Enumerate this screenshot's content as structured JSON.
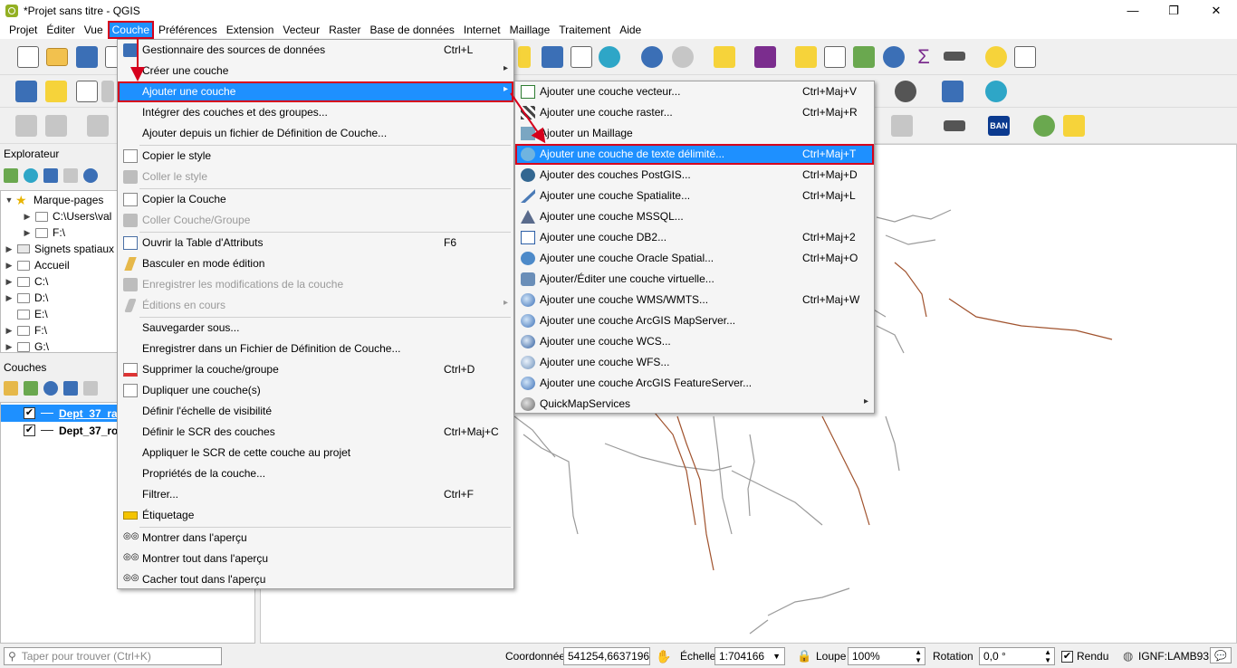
{
  "window": {
    "title": "*Projet sans titre - QGIS",
    "minimize": "—",
    "maximize": "❐",
    "close": "✕"
  },
  "menubar": [
    {
      "label": "Projet"
    },
    {
      "label": "Éditer"
    },
    {
      "label": "Vue"
    },
    {
      "label": "Couche"
    },
    {
      "label": "Préférences"
    },
    {
      "label": "Extension"
    },
    {
      "label": "Vecteur"
    },
    {
      "label": "Raster"
    },
    {
      "label": "Base de données"
    },
    {
      "label": "Internet"
    },
    {
      "label": "Maillage"
    },
    {
      "label": "Traitement"
    },
    {
      "label": "Aide"
    }
  ],
  "toolbar": {
    "ban_label": "BAN"
  },
  "browser": {
    "title": "Explorateur",
    "items": [
      {
        "label": "Marque-pages"
      },
      {
        "label": "C:\\Users\\val"
      },
      {
        "label": "F:\\"
      },
      {
        "label": "Signets spatiaux"
      },
      {
        "label": "Accueil"
      },
      {
        "label": "C:\\"
      },
      {
        "label": "D:\\"
      },
      {
        "label": "E:\\"
      },
      {
        "label": "F:\\"
      },
      {
        "label": "G:\\"
      }
    ]
  },
  "layers": {
    "title": "Couches",
    "items": [
      {
        "label": "Dept_37_ra",
        "checked": "✔"
      },
      {
        "label": "Dept_37_ro",
        "checked": "✔"
      }
    ]
  },
  "couche_menu": {
    "items": [
      {
        "label": "Gestionnaire des sources de données",
        "shortcut": "Ctrl+L"
      },
      {
        "label": "Créer une couche",
        "submenu": "▸"
      },
      {
        "label": "Ajouter une couche",
        "submenu": "▸"
      },
      {
        "label": "Intégrer des couches et des groupes..."
      },
      {
        "label": "Ajouter depuis un fichier de Définition de Couche..."
      },
      {
        "label": "Copier le style"
      },
      {
        "label": "Coller le style"
      },
      {
        "label": "Copier la Couche"
      },
      {
        "label": "Coller Couche/Groupe"
      },
      {
        "label": "Ouvrir la Table d'Attributs",
        "shortcut": "F6"
      },
      {
        "label": "Basculer en mode édition"
      },
      {
        "label": "Enregistrer les modifications de la couche"
      },
      {
        "label": "Éditions en cours",
        "submenu": "▸"
      },
      {
        "label": "Sauvegarder sous..."
      },
      {
        "label": "Enregistrer dans un Fichier de Définition de Couche..."
      },
      {
        "label": "Supprimer la couche/groupe",
        "shortcut": "Ctrl+D"
      },
      {
        "label": "Dupliquer une couche(s)"
      },
      {
        "label": "Définir l'échelle de visibilité"
      },
      {
        "label": "Définir le SCR des couches",
        "shortcut": "Ctrl+Maj+C"
      },
      {
        "label": "Appliquer le SCR de cette couche au projet"
      },
      {
        "label": "Propriétés de la couche..."
      },
      {
        "label": "Filtrer...",
        "shortcut": "Ctrl+F"
      },
      {
        "label": "Étiquetage"
      },
      {
        "label": "Montrer dans l'aperçu"
      },
      {
        "label": "Montrer tout dans l'aperçu"
      },
      {
        "label": "Cacher tout dans l'aperçu"
      }
    ]
  },
  "add_layer_menu": {
    "items": [
      {
        "label": "Ajouter une couche vecteur...",
        "shortcut": "Ctrl+Maj+V"
      },
      {
        "label": "Ajouter une couche raster...",
        "shortcut": "Ctrl+Maj+R"
      },
      {
        "label": "Ajouter un Maillage"
      },
      {
        "label": "Ajouter une couche de texte délimité...",
        "shortcut": "Ctrl+Maj+T"
      },
      {
        "label": "Ajouter des couches PostGIS...",
        "shortcut": "Ctrl+Maj+D"
      },
      {
        "label": "Ajouter une couche Spatialite...",
        "shortcut": "Ctrl+Maj+L"
      },
      {
        "label": "Ajouter une couche MSSQL..."
      },
      {
        "label": "Ajouter une couche DB2...",
        "shortcut": "Ctrl+Maj+2"
      },
      {
        "label": "Ajouter une couche Oracle Spatial...",
        "shortcut": "Ctrl+Maj+O"
      },
      {
        "label": "Ajouter/Éditer une couche virtuelle..."
      },
      {
        "label": "Ajouter une couche WMS/WMTS...",
        "shortcut": "Ctrl+Maj+W"
      },
      {
        "label": "Ajouter une couche ArcGIS MapServer..."
      },
      {
        "label": "Ajouter une couche WCS..."
      },
      {
        "label": "Ajouter une couche WFS..."
      },
      {
        "label": "Ajouter une couche ArcGIS FeatureServer..."
      },
      {
        "label": "QuickMapServices",
        "submenu": "▸"
      }
    ]
  },
  "statusbar": {
    "search_placeholder": "Taper pour trouver (Ctrl+K)",
    "coord_label": "Coordonnée",
    "coord_value": "541254,6637196",
    "scale_label": "Échelle",
    "scale_value": "1:704166",
    "zoom_label": "Loupe",
    "zoom_value": "100%",
    "rotation_label": "Rotation",
    "rotation_value": "0,0 °",
    "render_label": "Rendu",
    "render_checked": "✔",
    "crs": "IGNF:LAMB93"
  },
  "colors": {
    "highlight": "#1e90ff",
    "annotation_red": "#d6001c",
    "road_brown": "#a0522d",
    "road_grey": "#9a9a9a"
  }
}
